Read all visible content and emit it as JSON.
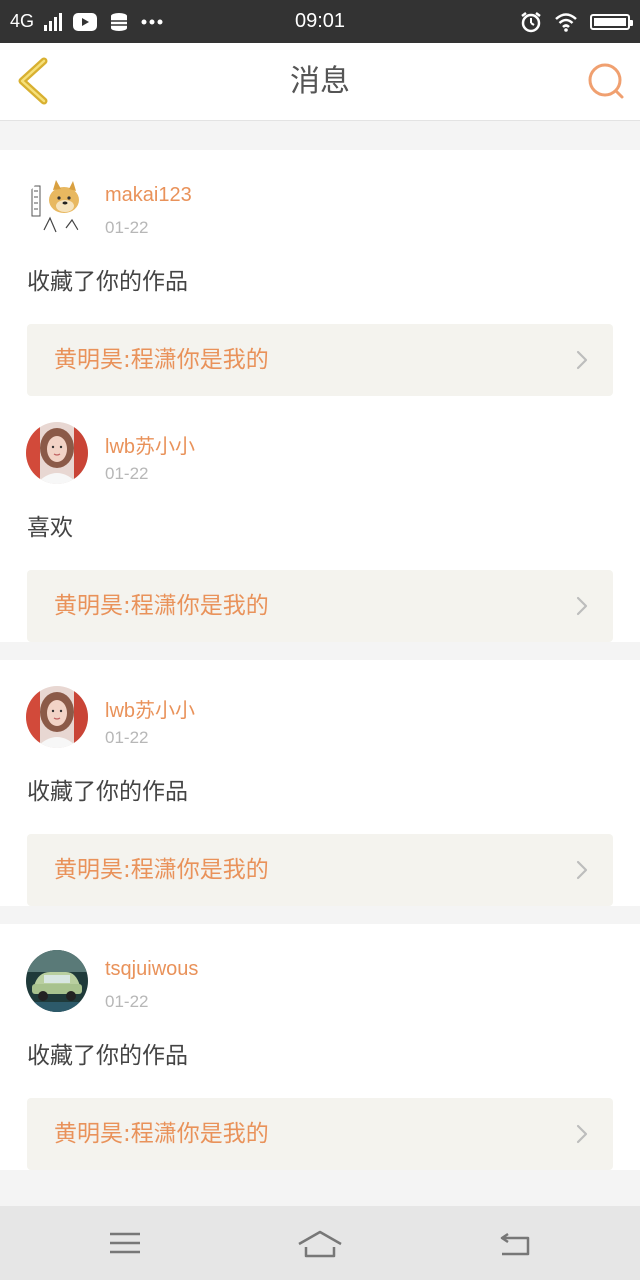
{
  "status_bar": {
    "network": "4G",
    "time": "09:01"
  },
  "header": {
    "title": "消息"
  },
  "messages": [
    {
      "user": "makai123",
      "date": "01-22",
      "action": "收藏了你的作品",
      "work": "黄明昊:程潇你是我的",
      "avatar": "doge-avatar"
    },
    {
      "user": "lwb苏小小",
      "date": "01-22",
      "action": "喜欢",
      "work": "黄明昊:程潇你是我的",
      "avatar": "girl-avatar"
    },
    {
      "user": "lwb苏小小",
      "date": "01-22",
      "action": "收藏了你的作品",
      "work": "黄明昊:程潇你是我的",
      "avatar": "girl-avatar"
    },
    {
      "user": "tsqjuiwous",
      "date": "01-22",
      "action": "收藏了你的作品",
      "work": "黄明昊:程潇你是我的",
      "avatar": "car-avatar"
    }
  ],
  "colors": {
    "accent": "#e9925a",
    "status_bar": "#333333",
    "reference_bg": "#f4f3ee"
  },
  "icons": {
    "back": "back-chevron-icon",
    "search": "search-icon",
    "menu": "menu-icon",
    "home": "home-icon",
    "return": "return-icon"
  }
}
